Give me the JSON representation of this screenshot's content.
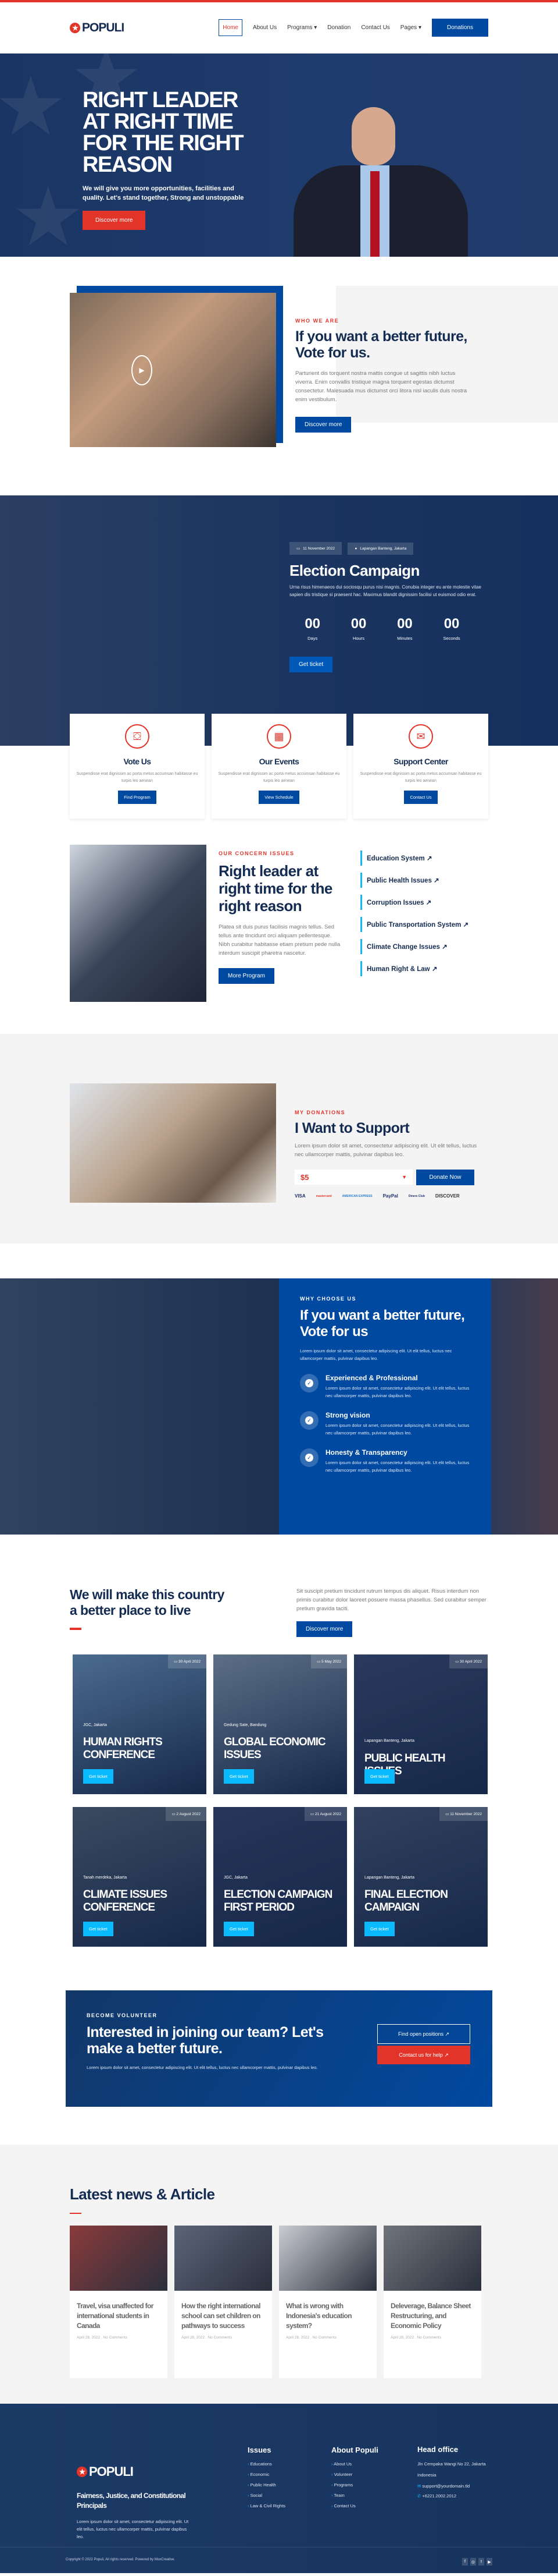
{
  "header": {
    "logo": "POPULI",
    "nav": [
      "Home",
      "About Us",
      "Programs",
      "Donation",
      "Contact Us",
      "Pages"
    ],
    "nav_dropdowns": [
      "Programs",
      "Pages"
    ],
    "cta": "Donations"
  },
  "hero": {
    "title": "RIGHT LEADER AT RIGHT TIME FOR THE RIGHT REASON",
    "subtitle": "We will give you more opportunities, facilities and quality. Let's stand together, Strong and unstoppable",
    "button": "Discover more"
  },
  "about": {
    "kicker": "WHO WE ARE",
    "title": "If you want a better future, Vote for us.",
    "body": "Parturient dis torquent nostra mattis congue ut sagittis nibh luctus viverra. Enim convallis tristique magna torquent egestas dictumst consectetur. Malesuada mus dictumst orci litora nisl iaculis duis nostra enim vestibulum.",
    "button": "Discover more"
  },
  "election": {
    "date": "11 November 2022",
    "location": "Lapangan Banteng, Jakarta",
    "title": "Election Campaign",
    "body": "Urna risus himenaeos dui sociosqu purus nisi magnis. Conubia integer eu ante molestie vitae sapien dis tristique si praesent hac. Maximus blandit dignissim facilisi ut euismod odio erat.",
    "countdown": [
      {
        "value": "00",
        "label": "Days"
      },
      {
        "value": "00",
        "label": "Hours"
      },
      {
        "value": "00",
        "label": "Minutes"
      },
      {
        "value": "00",
        "label": "Seconds"
      }
    ],
    "button": "Get ticket"
  },
  "features": [
    {
      "icon": "ballot-icon",
      "title": "Vote Us",
      "body": "Suspendisse erat dignissim ac porta metus accumsan habitasse eu turpis leo aenean",
      "button": "Find Program"
    },
    {
      "icon": "calendar-icon",
      "title": "Our Events",
      "body": "Suspendisse erat dignissim ac porta metus accumsan habitasse eu turpis leo aenean",
      "button": "View Schedule"
    },
    {
      "icon": "envelope-icon",
      "title": "Support Center",
      "body": "Suspendisse erat dignissim ac porta metus accumsan habitasse eu turpis leo aenean",
      "button": "Contact Us"
    }
  ],
  "issues": {
    "kicker": "OUR CONCERN ISSUES",
    "title": "Right leader at right time for the right reason",
    "body": "Platea sit duis purus facilisis magnis tellus. Sed tellus ante tincidunt orci aliquam pellentesque. Nibh curabitur habitasse etiam pretium pede nulla interdum suscipit pharetra nascetur.",
    "button": "More Program",
    "list": [
      "Education System",
      "Public Health Issues",
      "Corruption Issues",
      "Public Transportation System",
      "Climate Change Issues",
      "Human Right & Law"
    ]
  },
  "donate": {
    "kicker": "MY DONATIONS",
    "title": "I Want to Support",
    "body": "Lorem ipsum dolor sit amet, consectetur adipiscing elit. Ut elit tellus, luctus nec ullamcorper mattis, pulvinar dapibus leo.",
    "amount": "$5",
    "button": "Donate Now",
    "payments": [
      "VISA",
      "mastercard",
      "AMERICAN EXPRESS",
      "PayPal",
      "Diners Club",
      "DISCOVER"
    ]
  },
  "why": {
    "kicker": "WHY CHOOSE US",
    "title": "If you want a better future, Vote for us",
    "body": "Lorem ipsum dolor sit amet, consectetur adipiscing elit. Ut elit tellus, luctus nec ullamcorper mattis, pulvinar dapibus leo.",
    "points": [
      {
        "title": "Experienced & Professional",
        "body": "Lorem ipsum dolor sit amet, consectetur adipiscing elit. Ut elit tellus, luctus nec ullamcorper mattis, pulvinar dapibus leo."
      },
      {
        "title": "Strong vision",
        "body": "Lorem ipsum dolor sit amet, consectetur adipiscing elit. Ut elit tellus, luctus nec ullamcorper mattis, pulvinar dapibus leo."
      },
      {
        "title": "Honesty & Transparency",
        "body": "Lorem ipsum dolor sit amet, consectetur adipiscing elit. Ut elit tellus, luctus nec ullamcorper mattis, pulvinar dapibus leo."
      }
    ]
  },
  "better": {
    "title": "We will make this country a better place to live",
    "body": "Sit suscipit pretium tincidunt rutrum tempus dis aliquet. Risus interdum non primis curabitur dolor laoreet posuere massa phasellus. Sed curabitur semper pretium gravida taciti.",
    "button": "Discover more"
  },
  "events": [
    {
      "date": "30 April 2022",
      "location": "JGC, Jakarta",
      "title": "HUMAN RIGHTS CONFERENCE",
      "button": "Get ticket"
    },
    {
      "date": "5 May 2022",
      "location": "Gedung Sate, Bandung",
      "title": "GLOBAL ECONOMIC ISSUES",
      "button": "Get ticket"
    },
    {
      "date": "30 April 2022",
      "location": "Lapangan Banteng, Jakarta",
      "title": "PUBLIC HEALTH ISSUES",
      "button": "Get ticket"
    },
    {
      "date": "2 August 2022",
      "location": "Tanah merdeka, Jakarta",
      "title": "CLIMATE ISSUES CONFERENCE",
      "button": "Get ticket"
    },
    {
      "date": "21 August 2022",
      "location": "JGC, Jakarta",
      "title": "ELECTION CAMPAIGN FIRST PERIOD",
      "button": "Get ticket"
    },
    {
      "date": "11 November 2022",
      "location": "Lapangan Banteng, Jakarta",
      "title": "FINAL ELECTION CAMPAIGN",
      "button": "Get ticket"
    }
  ],
  "volunteer": {
    "kicker": "BECOME VOLUNTEER",
    "title": "Interested in joining our team? Let's make a better future.",
    "body": "Lorem ipsum dolor sit amet, consectetur adipiscing elit. Ut elit tellus, luctus nec ullamcorper mattis, pulvinar dapibus leo.",
    "button1": "Find open positions ↗",
    "button2": "Contact us for help ↗"
  },
  "news": {
    "title": "Latest news & Article",
    "articles": [
      {
        "title": "Travel, visa unaffected for international students in Canada",
        "meta": "April 28, 2022 . No Comments"
      },
      {
        "title": "How the right international school can set children on pathways to success",
        "meta": "April 28, 2022 . No Comments"
      },
      {
        "title": "What is wrong with Indonesia's education system?",
        "meta": "April 28, 2022 . No Comments"
      },
      {
        "title": "Deleverage, Balance Sheet Restructuring, and Economic Policy",
        "meta": "April 28, 2022 . No Comments"
      }
    ]
  },
  "footer": {
    "logo": "POPULI",
    "tagline": "Fairness, Justice, and Constitutional Principals",
    "body": "Lorem ipsum dolor sit amet, consectetur adipiscing elit. Ut elit tellus, luctus nec ullamcorper mattis, pulvinar dapibus leo.",
    "issues_title": "Issues",
    "issues": [
      "Educations",
      "Economic",
      "Public Health",
      "Social",
      "Law & Civil Rights"
    ],
    "about_title": "About Populi",
    "about": [
      "About Us",
      "Volunteer",
      "Programs",
      "Team",
      "Contact Us"
    ],
    "office_title": "Head office",
    "address1": "Jln Cempaka Wangi No 22, Jakarta",
    "address2": "Indonesia",
    "email": "support@yourdomain.tld",
    "phone": "+6221.2002.2012",
    "copyright": "Copyright © 2022 Populi, All rights reserved. Powered by MoxCreative.",
    "social": [
      "facebook-icon",
      "instagram-icon",
      "twitter-icon",
      "youtube-icon"
    ]
  },
  "colors": {
    "primary": "#0049a0",
    "accent": "#e3342a",
    "navy": "#152c52",
    "cyan": "#0abaff"
  }
}
